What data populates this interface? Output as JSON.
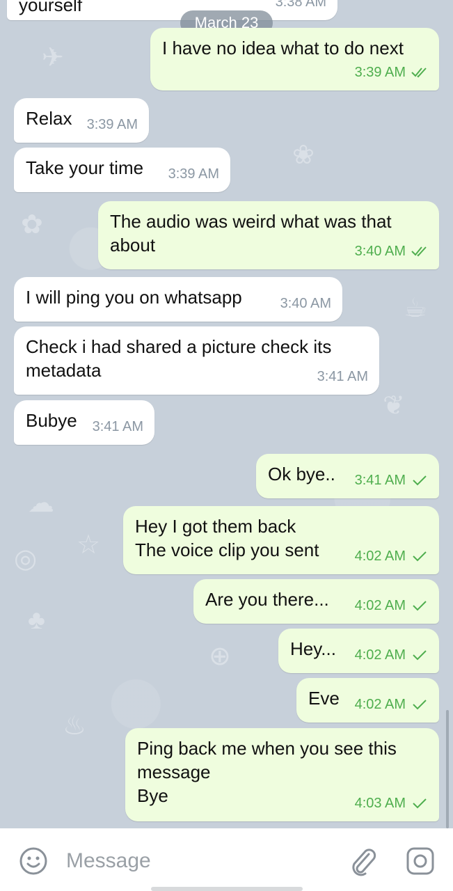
{
  "date_separator": "March 23",
  "partial_message": {
    "text": "yourself",
    "time": "3:38 AM"
  },
  "messages": [
    {
      "dir": "out",
      "text": "I have no idea what to do next",
      "time": "3:39 AM",
      "status": "read"
    },
    {
      "dir": "in",
      "text": "Relax",
      "time": "3:39 AM"
    },
    {
      "dir": "in",
      "text": "Take your time",
      "time": "3:39 AM"
    },
    {
      "dir": "out",
      "text": "The audio was weird what was that\nabout",
      "time": "3:40 AM",
      "status": "read"
    },
    {
      "dir": "in",
      "text": "I will ping you on whatsapp",
      "time": "3:40 AM"
    },
    {
      "dir": "in",
      "text": "Check i had shared a picture check its\nmetadata",
      "time": "3:41 AM"
    },
    {
      "dir": "in",
      "text": "Bubye",
      "time": "3:41 AM"
    },
    {
      "dir": "out",
      "text": "Ok bye..",
      "time": "3:41 AM",
      "status": "sent"
    },
    {
      "dir": "out",
      "text": "Hey I got them back\nThe voice clip you sent",
      "time": "4:02 AM",
      "status": "sent"
    },
    {
      "dir": "out",
      "text": "Are you there...",
      "time": "4:02 AM",
      "status": "sent"
    },
    {
      "dir": "out",
      "text": "Hey...",
      "time": "4:02 AM",
      "status": "sent"
    },
    {
      "dir": "out",
      "text": "Eve",
      "time": "4:02 AM",
      "status": "sent"
    },
    {
      "dir": "out",
      "text": "Ping back me when you see this\nmessage\nBye",
      "time": "4:03 AM",
      "status": "sent"
    }
  ],
  "input": {
    "placeholder": "Message",
    "value": ""
  },
  "icons": {
    "emoji": "emoji-icon",
    "attach": "paperclip-icon",
    "camera": "camera-icon"
  },
  "colors": {
    "incoming_bubble": "#ffffff",
    "outgoing_bubble": "#effdde",
    "outgoing_time": "#4fae4e",
    "incoming_time": "#8b97a3"
  }
}
